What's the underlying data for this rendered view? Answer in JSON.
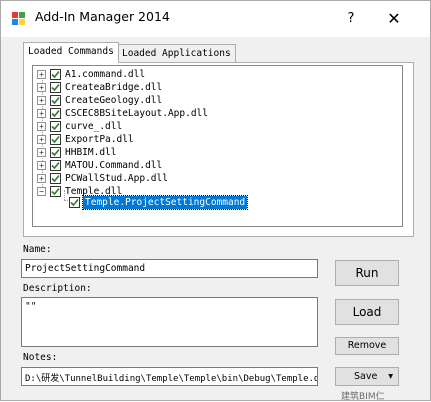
{
  "window": {
    "title": "Add-In Manager 2014",
    "help_glyph": "?",
    "close_glyph": "✕"
  },
  "tabs": [
    {
      "label": "Loaded Commands",
      "active": true
    },
    {
      "label": "Loaded Applications",
      "active": false
    }
  ],
  "tree": {
    "items": [
      {
        "label": "A1.command.dll",
        "expander": "+",
        "checked": true
      },
      {
        "label": "CreateaBridge.dll",
        "expander": "+",
        "checked": true
      },
      {
        "label": "CreateGeology.dll",
        "expander": "+",
        "checked": true
      },
      {
        "label": "CSCEC8BSiteLayout.App.dll",
        "expander": "+",
        "checked": true
      },
      {
        "label": "curve_.dll",
        "expander": "+",
        "checked": true
      },
      {
        "label": "ExportPa.dll",
        "expander": "+",
        "checked": true
      },
      {
        "label": "HHBIM.dll",
        "expander": "+",
        "checked": true
      },
      {
        "label": "MATOU.Command.dll",
        "expander": "+",
        "checked": true
      },
      {
        "label": "PCWallStud.App.dll",
        "expander": "+",
        "checked": true
      },
      {
        "label": "Temple.dll",
        "expander": "−",
        "checked": true
      }
    ],
    "child": {
      "label": "Temple.ProjectSettingCommand",
      "checked": true,
      "selected": true
    }
  },
  "name": {
    "label": "Name:",
    "value": "ProjectSettingCommand"
  },
  "description": {
    "label": "Description:",
    "value": "\"\""
  },
  "notes": {
    "label": "Notes:",
    "value": "D:\\研发\\TunnelBuilding\\Temple\\Temple\\bin\\Debug\\Temple.dll"
  },
  "buttons": {
    "run": "Run",
    "load": "Load",
    "remove": "Remove",
    "save": "Save"
  },
  "save_dropdown_glyph": "▾",
  "watermark": "建筑BIM仁",
  "colors": {
    "selection": "#0078d7",
    "check": "#2e7d32"
  }
}
